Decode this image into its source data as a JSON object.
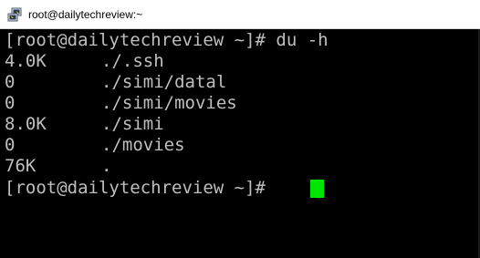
{
  "window": {
    "title": "root@dailytechreview:~",
    "icon": "putty-icon"
  },
  "terminal": {
    "command_line": "[root@dailytechreview ~]# du -h",
    "output": [
      {
        "size": "4.0K",
        "path": "./.ssh"
      },
      {
        "size": "0",
        "path": "./simi/datal"
      },
      {
        "size": "0",
        "path": "./simi/movies"
      },
      {
        "size": "8.0K",
        "path": "./simi"
      },
      {
        "size": "0",
        "path": "./movies"
      },
      {
        "size": "76K",
        "path": "."
      }
    ],
    "prompt": "[root@dailytechreview ~]# ",
    "cursor_color": "#00e600",
    "text_color": "#bfbfbf",
    "background_color": "#000000"
  }
}
